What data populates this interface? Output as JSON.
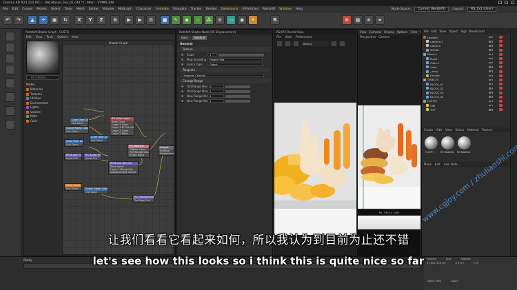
{
  "window": {
    "title": "Cinema 4D R23.110 (RC) - [08_Macon_Tex_01.c4d *] - Main - VYMM_IOB"
  },
  "menubar": {
    "items": [
      "File",
      "Edit",
      "Create",
      "Modes",
      "Select",
      "Tools",
      "Mesh",
      "Spline",
      "Volume",
      "MoGraph",
      "Character",
      "Animate",
      "Simulate",
      "Tracker",
      "Render",
      "Extensions",
      "X-Particles",
      "Redshift",
      "Window",
      "Help"
    ],
    "node_space_label": "Node Space:",
    "node_space_value": "Current (Redshift)",
    "layout_label": "Layout:",
    "layout_value": "RS_1x1 (User)"
  },
  "shader_graph": {
    "window_title": "Redshift Shader Graph - CUSTH",
    "menu": [
      "Edit",
      "View",
      "Tools",
      "Options",
      "Help"
    ],
    "canvas_title": "Shader Graph",
    "search_placeholder": "Find Nodes...",
    "nodes_label": "Nodes",
    "tree": [
      {
        "label": "Materials",
        "kind": "orange"
      },
      {
        "label": "Textures",
        "kind": "orange"
      },
      {
        "label": "Utilities",
        "kind": "teal"
      },
      {
        "label": "Environment",
        "kind": "orange"
      },
      {
        "label": "Lights",
        "kind": "pur"
      },
      {
        "label": "Volume",
        "kind": "orange"
      },
      {
        "label": "Math",
        "kind": "grn"
      },
      {
        "label": "Color",
        "kind": "orange"
      }
    ],
    "nodes": {
      "color_user_data": {
        "title": "Color User Data",
        "lines": [
          "Out Color"
        ]
      },
      "scalar_ramp": {
        "title": "Scalar Ramp Color",
        "lines": [
          "Out Color"
        ]
      },
      "rs_color_layer": {
        "title": "RS Color Layer",
        "lines": [
          "Base Color",
          "Layer 1 Color",
          "Layer 1 M Out Color",
          "Layer 2 Color",
          "Layer 2 Mask"
        ]
      },
      "color_user2": {
        "title": "Color User Data",
        "lines": [
          "Out Color"
        ]
      },
      "color_user3": {
        "title": "Color User Data",
        "lines": [
          "Out Color"
        ]
      },
      "rs_material": {
        "title": "RS Material",
        "lines": [
          "Diffuse Color",
          "Refl Roughness Out Color",
          "Bump Input"
        ]
      },
      "output": {
        "title": "Output",
        "lines": [
          "Surface",
          "Displacement"
        ]
      },
      "rs_bump_map": {
        "title": "RS Bump Map",
        "lines": [
          "Input Out"
        ]
      },
      "rs_bump_map2": {
        "title": "RS Bump Map",
        "lines": [
          "Input Out"
        ]
      },
      "rs_bump_blender": {
        "title": "RS Bump Blender",
        "lines": [
          "Base Input",
          "Layer 1 Bump Out",
          "Displacement Vector"
        ]
      },
      "color_layer2": {
        "title": "Color Layer",
        "lines": [
          "Out Color"
        ]
      },
      "scalar_ramp2": {
        "title": "Scalar Ramp Color",
        "lines": [
          "Out Color"
        ]
      },
      "rs_displacement": {
        "title": "RS Displacement",
        "lines": [
          "Tex Map Out"
        ]
      }
    }
  },
  "attributes": {
    "title": "Redshift Shader Node [RS Displacement]",
    "tabs": [
      "Basic",
      "General"
    ],
    "section_general": "General",
    "group_texture": "Texture",
    "rows_texture": [
      {
        "label": "Scale",
        "value": "1"
      },
      {
        "label": "Map Encoding",
        "value": "Height Field"
      },
      {
        "label": "Space Type",
        "value": "Object"
      }
    ],
    "group_tangents": "Tangents",
    "tangents_value": "Tangents Channel",
    "group_change_range": "Change Range",
    "rows_range": [
      {
        "label": "Old Range Min",
        "value": "0"
      },
      {
        "label": "Old Range Max",
        "value": "1"
      },
      {
        "label": "New Range Min",
        "value": "0"
      },
      {
        "label": "New Range Max",
        "value": "1"
      }
    ]
  },
  "render_view": {
    "title": "RS/VFX RenderView",
    "menu": [
      "File",
      "View",
      "Preferences"
    ],
    "dropdown": "Beauty"
  },
  "viewport": {
    "menu": [
      "View",
      "Cameras",
      "Display",
      "Options",
      "Filter",
      "Panel"
    ],
    "menu2": [
      "Perspective",
      "Camera"
    ],
    "render_resolution": "RS: 1920 x 1080"
  },
  "object_manager": {
    "menu": [
      "File",
      "Edit",
      "View",
      "Object",
      "Tags",
      "Bookmarks"
    ],
    "objects": [
      {
        "name": "Lowpoly",
        "color": "#c06a3a"
      },
      {
        "name": "Camera.1",
        "color": "#c8c8c8"
      },
      {
        "name": "Camera",
        "color": "#c8c8c8"
      },
      {
        "name": "SCENE",
        "color": "#9a9a9a"
      },
      {
        "name": "Plane.1",
        "color": "#6aa8d8"
      },
      {
        "name": "Plane",
        "color": "#6aa8d8"
      },
      {
        "name": "Cube.1",
        "color": "#6aa8d8"
      },
      {
        "name": "Cube",
        "color": "#6aa8d8"
      },
      {
        "name": "_wing",
        "color": "#6aa8d8"
      },
      {
        "name": "Gravity",
        "color": "#d8a84a"
      },
      {
        "name": "OBJECTS",
        "color": "#9a9a9a"
      },
      {
        "name": "BLOCK_01",
        "color": "#6aa8d8"
      },
      {
        "name": "BLOCK_02",
        "color": "#6aa8d8"
      },
      {
        "name": "BLOCK_03",
        "color": "#6aa8d8"
      },
      {
        "name": "BLOCK_04",
        "color": "#6aa8d8"
      },
      {
        "name": "LIGHTS",
        "color": "#9a9a9a"
      },
      {
        "name": "RIM",
        "color": "#d8c84a"
      },
      {
        "name": "TOP",
        "color": "#d8c84a"
      }
    ],
    "material_menu": [
      "Create",
      "Edit",
      "View",
      "Select",
      "Material",
      "Texture"
    ],
    "materials": [
      "CUSTH",
      "RS Material",
      "RS Material"
    ],
    "attr_menu": [
      "Mode",
      "Edit",
      "User Data"
    ]
  },
  "timeline": {
    "ready": "Ready"
  },
  "coords": {
    "headers": [
      "Position",
      "Size",
      "Rotation"
    ],
    "values": [
      "X  1001.378 cm",
      "X  0 cm",
      "H  0°"
    ],
    "object_mode": "Object (Rel)",
    "apply_label": "Apply"
  },
  "subtitles": {
    "zh": "让我们看看它看起来如何，所以我认为到目前为止还不错",
    "en": "let's see how this looks so i think this is quite nice so far"
  },
  "watermark": "www.cgjoy.com / zhuliaoshi.com"
}
